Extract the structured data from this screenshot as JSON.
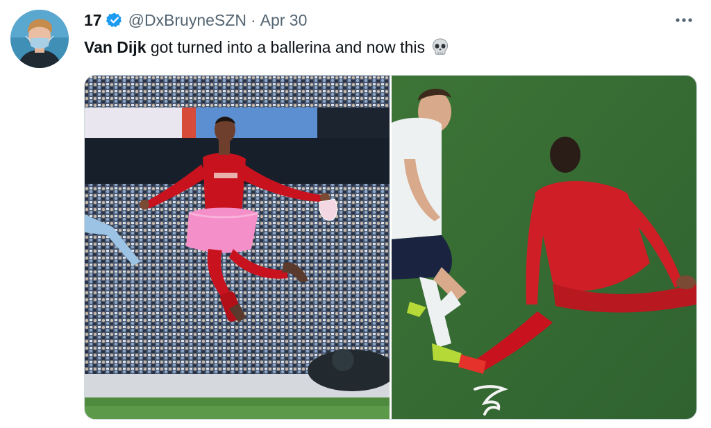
{
  "tweet": {
    "display_name": "17",
    "handle": "@DxBruyneSZN",
    "separator": "·",
    "date": "Apr 30",
    "text_bold": "Van Dijk",
    "text_rest": " got turned into a ballerina and now this",
    "emoji": "skull-icon",
    "more_icon": "more-dots-icon",
    "verified_color": "#1d9bf0",
    "secondary_text_color": "#536471"
  }
}
